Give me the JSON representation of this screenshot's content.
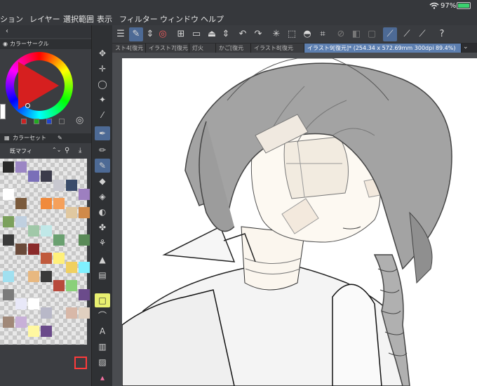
{
  "menu": {
    "items": [
      "ション",
      "レイヤー",
      "選択範囲",
      "表示",
      "フィルター",
      "ウィンドウ",
      "ヘルプ"
    ]
  },
  "status": {
    "battery_text": "97%"
  },
  "color_panel": {
    "title": "カラーサークル"
  },
  "colorset_panel": {
    "title": "カラーセット",
    "set_name": "既マフィ"
  },
  "tabs": [
    {
      "label": "スト4[復元"
    },
    {
      "label": "イラスト7[復元"
    },
    {
      "label": "灯火"
    },
    {
      "label": "かご[復元"
    },
    {
      "label": "イラスト8[復元"
    },
    {
      "label": "イラスト9[復元]* (254.34 x 572.69mm 300dpi 89.4%)"
    }
  ],
  "palette": {
    "colors": [
      [
        "#2a2a2a",
        "#9b86c4",
        "#7a6fb8",
        "#3b3b4a",
        "#c8c8d0",
        "#3a4b6a",
        "#9d7fc0",
        "#ffffff",
        "#7a5a3c"
      ],
      [
        "#f08a3c",
        "#f5a05a",
        "#e0c8a0",
        "#d08a4a",
        "#7ba05c",
        "#c0d0e0",
        "#a0c8a8",
        "#c0e8e8",
        "#6aa070"
      ],
      [
        "#5a8a58",
        "#3a3a3a",
        "#6a4a3a",
        "#8a2a2a",
        "#c05a3c",
        "#fff07a",
        "#f0d060",
        "#7ff0ff",
        "#a0e0f0"
      ],
      [
        "#e8b880",
        "#3a3a3a",
        "#b84a3c",
        "#8ad07a",
        "#6b4b8b",
        "#7b7b7b",
        "#e8e8f8",
        "#ffffff",
        "#b8b8c8"
      ],
      [
        "#d8b8a8",
        "#e0d0c0",
        "#a08878",
        "#c8b0d8",
        "#fff8a0",
        "#6a4a8a"
      ]
    ]
  }
}
